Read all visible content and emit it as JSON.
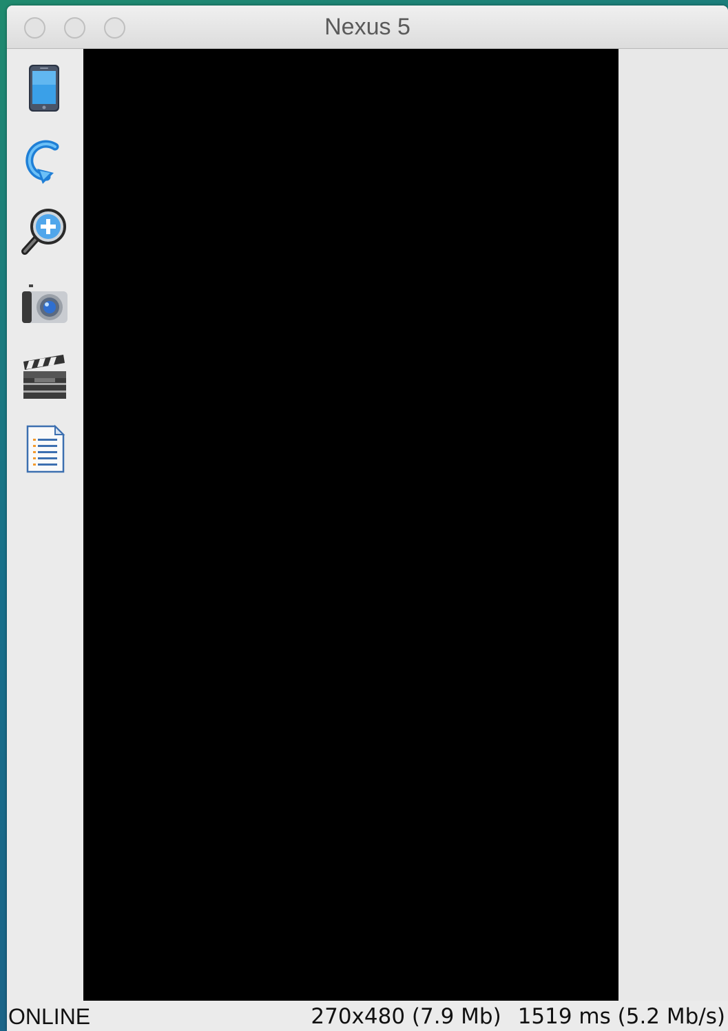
{
  "window": {
    "title": "Nexus 5"
  },
  "toolbar": {
    "items": [
      {
        "icon": "phone-icon"
      },
      {
        "icon": "rotate-icon"
      },
      {
        "icon": "zoom-in-icon"
      },
      {
        "icon": "camera-icon"
      },
      {
        "icon": "clapperboard-icon"
      },
      {
        "icon": "document-icon"
      }
    ]
  },
  "status": {
    "connection": "ONLINE",
    "resolution": "270x480 (7.9 Mb)",
    "timing": "1519 ms (5.2 Mb/s)"
  }
}
